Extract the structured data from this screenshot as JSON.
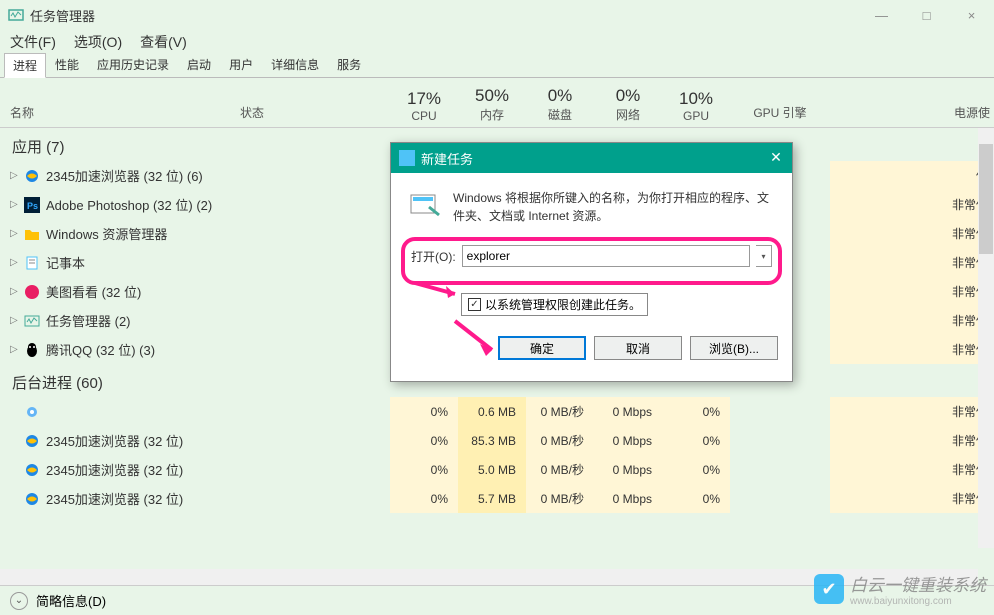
{
  "window": {
    "title": "任务管理器",
    "minimize": "—",
    "maximize": "□",
    "close": "×"
  },
  "menu": {
    "file": "文件(F)",
    "options": "选项(O)",
    "view": "查看(V)"
  },
  "tabs": {
    "processes": "进程",
    "performance": "性能",
    "history": "应用历史记录",
    "startup": "启动",
    "users": "用户",
    "details": "详细信息",
    "services": "服务"
  },
  "headers": {
    "name": "名称",
    "status": "状态",
    "cpu_pct": "17%",
    "cpu": "CPU",
    "mem_pct": "50%",
    "mem": "内存",
    "disk_pct": "0%",
    "disk": "磁盘",
    "net_pct": "0%",
    "net": "网络",
    "gpu_pct": "10%",
    "gpu": "GPU",
    "gpu_engine": "GPU 引擎",
    "power": "电源使"
  },
  "groups": {
    "apps": "应用 (7)",
    "background": "后台进程 (60)"
  },
  "apps": [
    {
      "name": "2345加速浏览器 (32 位) (6)",
      "icon": "ie"
    },
    {
      "name": "Adobe Photoshop (32 位) (2)",
      "icon": "ps"
    },
    {
      "name": "Windows 资源管理器",
      "icon": "folder"
    },
    {
      "name": "记事本",
      "icon": "notepad"
    },
    {
      "name": "美图看看 (32 位)",
      "icon": "meitu"
    },
    {
      "name": "任务管理器 (2)",
      "icon": "taskmgr"
    },
    {
      "name": "腾讯QQ (32 位) (3)",
      "icon": "qq"
    }
  ],
  "bg_rows": [
    {
      "name": "",
      "icon": "gear",
      "cpu": "0%",
      "mem": "0.6 MB",
      "disk": "0 MB/秒",
      "net": "0 Mbps",
      "gpu": "0%",
      "power": "非常低"
    },
    {
      "name": "2345加速浏览器 (32 位)",
      "icon": "ie",
      "cpu": "0%",
      "mem": "85.3 MB",
      "disk": "0 MB/秒",
      "net": "0 Mbps",
      "gpu": "0%",
      "power": "非常低"
    },
    {
      "name": "2345加速浏览器 (32 位)",
      "icon": "ie",
      "cpu": "0%",
      "mem": "5.0 MB",
      "disk": "0 MB/秒",
      "net": "0 Mbps",
      "gpu": "0%",
      "power": "非常低"
    },
    {
      "name": "2345加速浏览器 (32 位)",
      "icon": "ie",
      "cpu": "0%",
      "mem": "5.7 MB",
      "disk": "0 MB/秒",
      "net": "0 Mbps",
      "gpu": "0%",
      "power": "非常低"
    }
  ],
  "app_powers": [
    "低",
    "非常低",
    "非常低",
    "非常低",
    "非常低",
    "非常低",
    "非常低"
  ],
  "statusbar": {
    "brief": "简略信息(D)"
  },
  "dialog": {
    "title": "新建任务",
    "desc": "Windows 将根据你所键入的名称，为你打开相应的程序、文件夹、文档或 Internet 资源。",
    "open_label": "打开(O):",
    "input_value": "explorer",
    "admin_check": "以系统管理权限创建此任务。",
    "ok": "确定",
    "cancel": "取消",
    "browse": "浏览(B)..."
  },
  "watermark": {
    "text": "白云一键重装系统",
    "url": "www.baiyunxitong.com"
  }
}
